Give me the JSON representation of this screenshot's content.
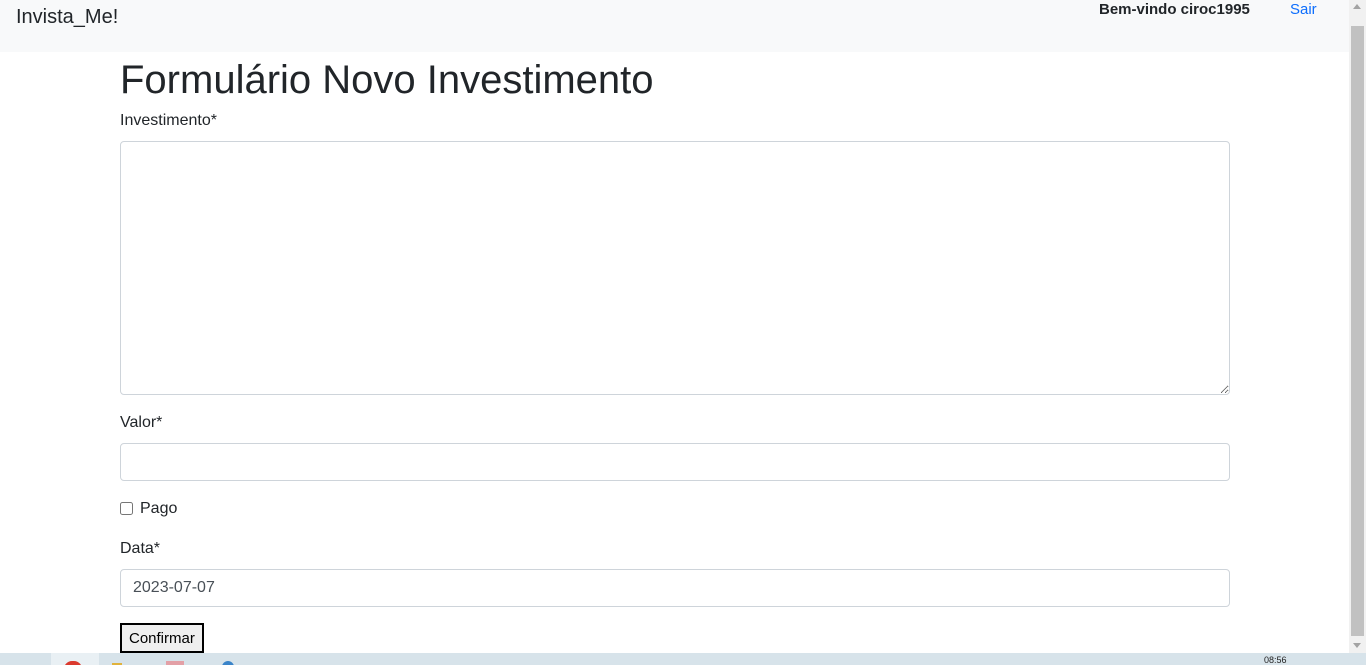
{
  "navbar": {
    "brand": "Invista_Me!",
    "welcome": "Bem-vindo ciroc1995",
    "logout_label": "Sair"
  },
  "form": {
    "title": "Formulário Novo Investimento",
    "investimento_label": "Investimento*",
    "investimento_value": "",
    "valor_label": "Valor*",
    "valor_value": "",
    "pago_label": "Pago",
    "pago_checked": false,
    "data_label": "Data*",
    "data_value": "2023-07-07",
    "confirm_label": "Confirmar"
  },
  "taskbar": {
    "time": "08:56",
    "icons": [
      "chrome-icon",
      "folder-icon",
      "document-icon",
      "app-icon"
    ]
  },
  "colors": {
    "navbar_bg": "#f8f9fa",
    "link": "#0d6efd",
    "input_border": "#ced4da",
    "text": "#212529"
  }
}
